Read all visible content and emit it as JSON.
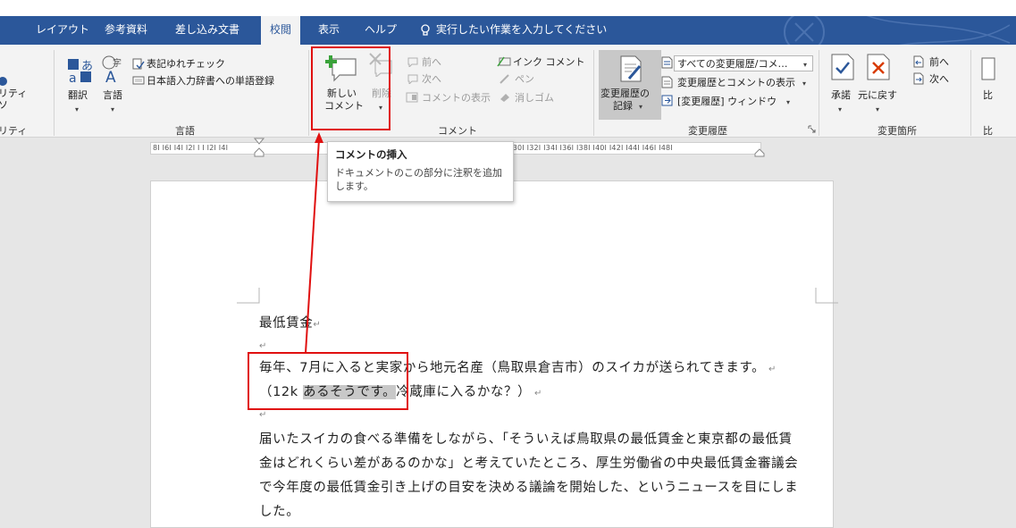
{
  "tabs": [
    {
      "label": "レイアウト"
    },
    {
      "label": "参考資料"
    },
    {
      "label": "差し込み文書"
    },
    {
      "label": "校閲"
    },
    {
      "label": "表示"
    },
    {
      "label": "ヘルプ"
    }
  ],
  "tell_me": "実行したい作業を入力してください",
  "ribbon": {
    "accessibility": {
      "line1": "リティ",
      "line2": "ソ",
      "group": "リティ"
    },
    "language": {
      "translate": "翻訳",
      "language": "言語",
      "proof_check": "表記ゆれチェック",
      "ime_dict": "日本語入力辞書への単語登録",
      "group": "言語"
    },
    "comments": {
      "new_line1": "新しい",
      "new_line2": "コメント",
      "delete": "削除",
      "prev": "前へ",
      "next": "次へ",
      "show": "コメントの表示",
      "ink": "インク コメント",
      "pen": "ペン",
      "eraser": "消しゴム",
      "group": "コメント"
    },
    "tracking": {
      "track_line1": "変更履歴の",
      "track_line2": "記録",
      "markup_select": "すべての変更履歴/コメ…",
      "show_markup": "変更履歴とコメントの表示",
      "pane": "[変更履歴] ウィンドウ",
      "group": "変更履歴"
    },
    "changes": {
      "accept": "承諾",
      "reject": "元に戻す",
      "prev": "前へ",
      "next": "次へ",
      "group": "変更箇所"
    },
    "extra_label": "比"
  },
  "ruler_ticks": "8I  I6I  I4I  I2I  I  I  I2I  I4I",
  "ruler_ticks_right": "I20I  I22I  I24I  I26I  I28I  I30I  I32I  I34I  I36I  I38I  I40I  I42I  I44I  I46I  I48I",
  "tooltip": {
    "title": "コメントの挿入",
    "body_line1": "ドキュメントのこの部分に注釈を追加",
    "body_line2": "します。"
  },
  "document": {
    "heading": "最低賃金",
    "p1": "毎年、7月に入ると実家から地元名産（鳥取県倉吉市）のスイカが送られてきます。",
    "p2_pre": "（12k ",
    "p2_selected": "あるそうです。",
    "p2_post": "冷蔵庫に入るかな？）",
    "p3_line1": "届いたスイカの食べる準備をしながら、「そういえば鳥取県の最低賃金と東京都の最低賃",
    "p3_line2": "金はどれくらい差があるのかな」と考えていたところ、厚生労働省の中央最低賃金審議会",
    "p3_line3": "で今年度の最低賃金引き上げの目安を決める議論を開始した、というニュースを目にしま",
    "p3_line4": "した。"
  },
  "colors": {
    "tab_bar": "#2b579a",
    "annotation": "#e01010",
    "selection": "#c8c8c8"
  }
}
